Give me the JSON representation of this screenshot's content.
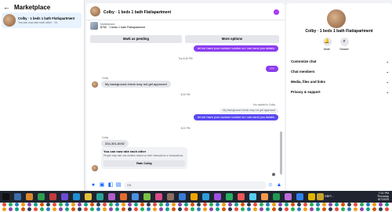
{
  "marketplace": {
    "title": "Marketplace",
    "conversation": {
      "title": "Colby · 1 beds 1 bath Flat/apartment",
      "subtitle": "You can now rate each other · 1h"
    }
  },
  "chat": {
    "title": "Colby · 1 beds 1 bath Flat/apartment",
    "listing_source": "Marketplace",
    "listing_price": "$750 · 1 beds 1 bath Flat/apartment",
    "mark_pending": "Mark as pending",
    "more_options": "More options",
    "messages": {
      "out_1": "let me have your contact number so i can send you details",
      "stamp_1": "Tue 8:49 PM",
      "out_2": "???",
      "sender_name": "Colby",
      "in_1": "My background check may not get approved",
      "stamp_2": "8:20 PM",
      "reply_note": "You replied to Colby",
      "reply_quote": "My background check may not get approved",
      "out_3": "let me have your contact number so i can send you details",
      "stamp_3": "8:21 PM",
      "sender_name_2": "Colby",
      "in_2": "334-301-6092"
    },
    "rate_card": {
      "title": "You can now rate each other",
      "subtitle": "People may rate one another based on their interactions or transactions.",
      "button": "Rate Colby"
    },
    "composer_placeholder": "Aa"
  },
  "details": {
    "title": "Colby · 1 beds 1 bath Flat/apartment",
    "actions": [
      {
        "label": "Mute",
        "icon": "bell-icon"
      },
      {
        "label": "Search",
        "icon": "search-icon"
      }
    ],
    "sections": [
      "Customize chat",
      "Chat members",
      "Media, files and links",
      "Privacy & support"
    ]
  },
  "taskbar": {
    "app_label": "GBP/...",
    "time": "7:21 PM",
    "day": "Thursday",
    "date": "8/7/2025"
  }
}
